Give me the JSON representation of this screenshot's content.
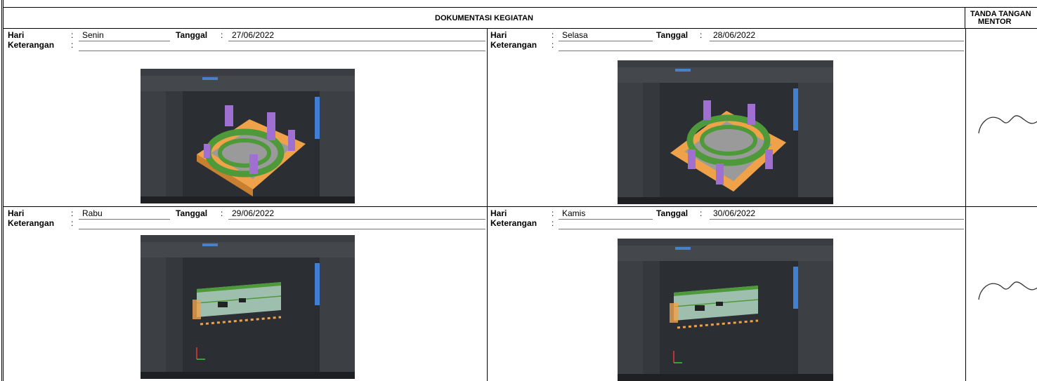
{
  "header": {
    "title": "DOKUMENTASI KEGIATAN",
    "sign_title_line1": "TANDA TANGAN",
    "sign_title_line2": "MENTOR"
  },
  "labels": {
    "day": "Hari",
    "date": "Tanggal",
    "note": "Keterangan",
    "colon": ":"
  },
  "entries": [
    {
      "day": "Senin",
      "date": "27/06/2022",
      "note": "",
      "shot": "bim-3d-model-view-ramp"
    },
    {
      "day": "Selasa",
      "date": "28/06/2022",
      "note": "",
      "shot": "bim-3d-model-view-ramp-top"
    },
    {
      "day": "Rabu",
      "date": "29/06/2022",
      "note": "",
      "shot": "bim-3d-model-view-elevation"
    },
    {
      "day": "Kamis",
      "date": "30/06/2022",
      "note": "",
      "shot": "bim-3d-model-view-elevation"
    }
  ],
  "colors": {
    "viewport": "#2b2e33",
    "slab": "#f0a24a",
    "structure_green": "#4e9a3a",
    "column_purple": "#a070d0",
    "accent_blue": "#3f7fd6"
  }
}
